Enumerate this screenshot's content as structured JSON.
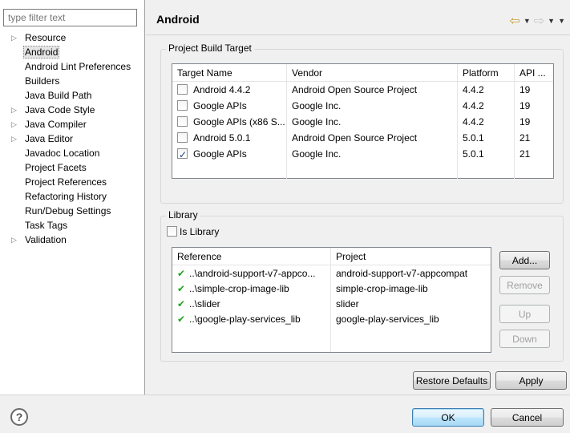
{
  "filter": {
    "placeholder": "type filter text"
  },
  "tree": {
    "items": [
      {
        "label": "Resource",
        "expandable": true
      },
      {
        "label": "Android",
        "expandable": false,
        "selected": true
      },
      {
        "label": "Android Lint Preferences",
        "expandable": false
      },
      {
        "label": "Builders",
        "expandable": false
      },
      {
        "label": "Java Build Path",
        "expandable": false
      },
      {
        "label": "Java Code Style",
        "expandable": true
      },
      {
        "label": "Java Compiler",
        "expandable": true
      },
      {
        "label": "Java Editor",
        "expandable": true
      },
      {
        "label": "Javadoc Location",
        "expandable": false
      },
      {
        "label": "Project Facets",
        "expandable": false
      },
      {
        "label": "Project References",
        "expandable": false
      },
      {
        "label": "Refactoring History",
        "expandable": false
      },
      {
        "label": "Run/Debug Settings",
        "expandable": false
      },
      {
        "label": "Task Tags",
        "expandable": false
      },
      {
        "label": "Validation",
        "expandable": true
      }
    ]
  },
  "header": {
    "title": "Android"
  },
  "build_target": {
    "title": "Project Build Target",
    "columns": [
      "Target Name",
      "Vendor",
      "Platform",
      "API ..."
    ],
    "rows": [
      {
        "checked": false,
        "name": "Android 4.4.2",
        "vendor": "Android Open Source Project",
        "platform": "4.4.2",
        "api": "19"
      },
      {
        "checked": false,
        "name": "Google APIs",
        "vendor": "Google Inc.",
        "platform": "4.4.2",
        "api": "19"
      },
      {
        "checked": false,
        "name": "Google APIs (x86 S...",
        "vendor": "Google Inc.",
        "platform": "4.4.2",
        "api": "19"
      },
      {
        "checked": false,
        "name": "Android 5.0.1",
        "vendor": "Android Open Source Project",
        "platform": "5.0.1",
        "api": "21"
      },
      {
        "checked": true,
        "name": "Google APIs",
        "vendor": "Google Inc.",
        "platform": "5.0.1",
        "api": "21"
      }
    ]
  },
  "library": {
    "title": "Library",
    "is_library_label": "Is Library",
    "is_library_checked": false,
    "columns": [
      "Reference",
      "Project"
    ],
    "rows": [
      {
        "reference": "..\\android-support-v7-appco...",
        "project": "android-support-v7-appcompat"
      },
      {
        "reference": "..\\simple-crop-image-lib",
        "project": "simple-crop-image-lib"
      },
      {
        "reference": "..\\slider",
        "project": "slider"
      },
      {
        "reference": "..\\google-play-services_lib",
        "project": "google-play-services_lib"
      }
    ],
    "buttons": {
      "add": "Add...",
      "remove": "Remove",
      "up": "Up",
      "down": "Down"
    }
  },
  "actions": {
    "restore_defaults": "Restore Defaults",
    "apply": "Apply"
  },
  "footer": {
    "help": "?",
    "ok": "OK",
    "cancel": "Cancel"
  },
  "colors": {
    "check_green": "#1ea51e",
    "default_button_border": "#3c7fb1"
  }
}
